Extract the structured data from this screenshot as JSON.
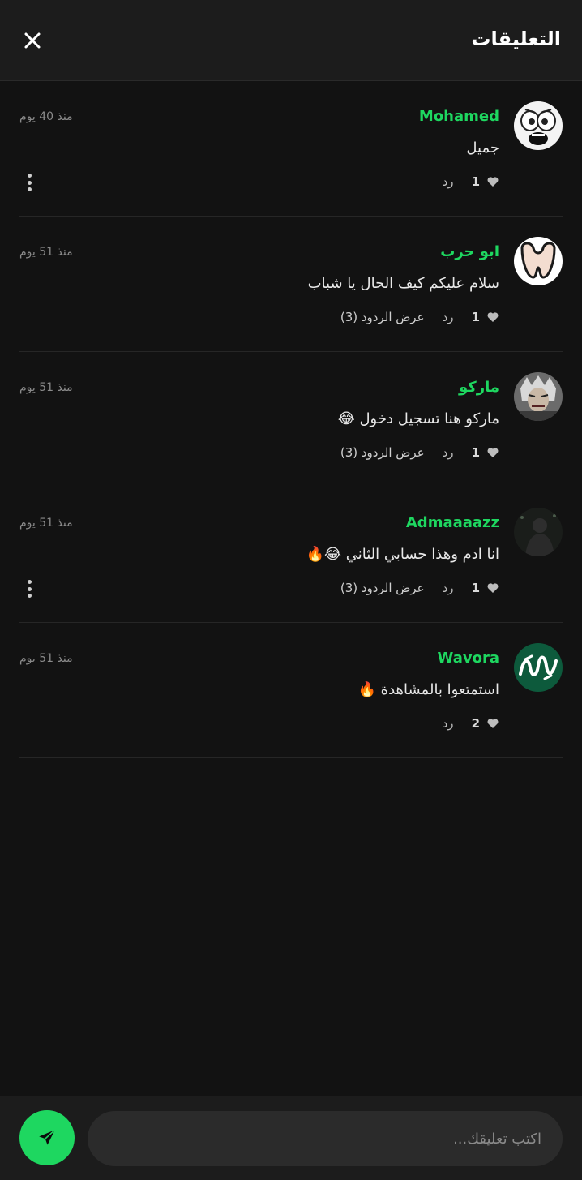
{
  "header": {
    "title": "التعليقات",
    "close_icon": "close-icon"
  },
  "colors": {
    "background": "#121212",
    "header_bg": "#1c1c1c",
    "accent": "#1ed760",
    "username": "#1ed760",
    "muted": "#8a8a8a"
  },
  "comments": [
    {
      "username": "Mohamed",
      "time": "منذ 40 يوم",
      "text": "جميل",
      "likes": "1",
      "reply_label": "رد",
      "view_replies": "",
      "has_more_menu": true,
      "avatar_icon": "cartoon-face-avatar"
    },
    {
      "username": "ابو حرب",
      "time": "منذ 51 يوم",
      "text": "سلام عليكم كيف الحال يا شباب",
      "likes": "1",
      "reply_label": "رد",
      "view_replies": "عرض الردود (3)",
      "has_more_menu": false,
      "avatar_icon": "tooth-logo-avatar"
    },
    {
      "username": "ماركو",
      "time": "منذ 51 يوم",
      "text": "ماركو هنا تسجيل دخول 😂",
      "likes": "1",
      "reply_label": "رد",
      "view_replies": "عرض الردود (3)",
      "has_more_menu": false,
      "avatar_icon": "anime-character-avatar"
    },
    {
      "username": "Admaaaazz",
      "time": "منذ 51 يوم",
      "text": "انا ادم وهذا حسابي الثاني 😂🔥",
      "likes": "1",
      "reply_label": "رد",
      "view_replies": "عرض الردود (3)",
      "has_more_menu": true,
      "avatar_icon": "dark-photo-avatar"
    },
    {
      "username": "Wavora",
      "time": "منذ 51 يوم",
      "text": "استمتعوا بالمشاهدة 🔥",
      "likes": "2",
      "reply_label": "رد",
      "view_replies": "",
      "has_more_menu": false,
      "avatar_icon": "green-logo-avatar"
    }
  ],
  "composer": {
    "placeholder": "اكتب تعليقك...",
    "value": "",
    "send_icon": "send-icon"
  }
}
